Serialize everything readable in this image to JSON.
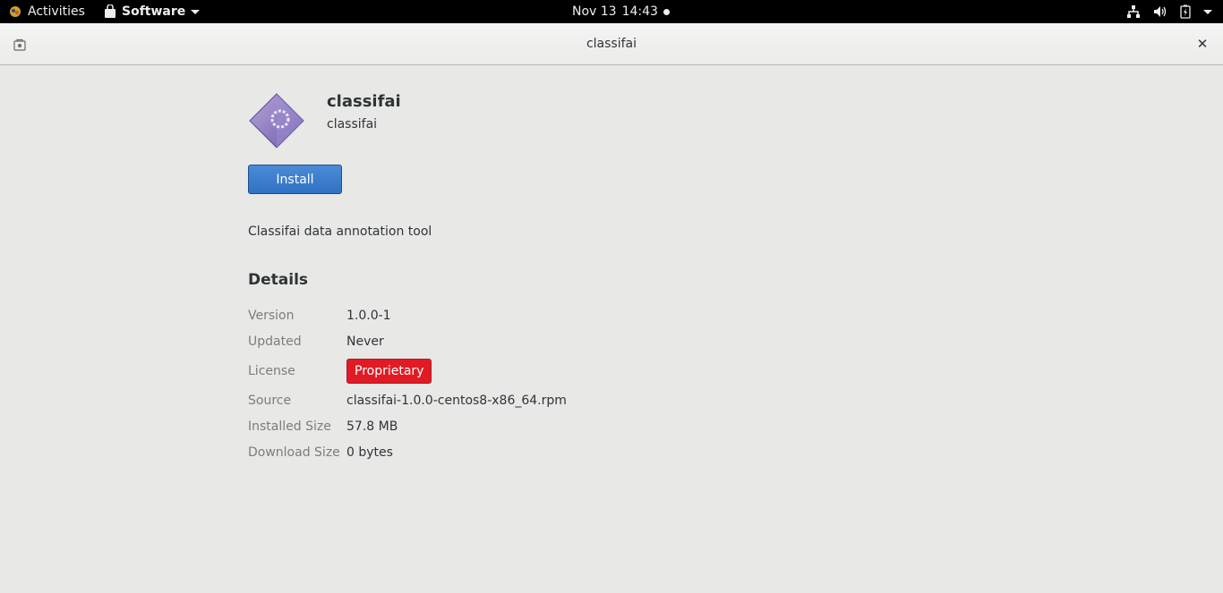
{
  "topbar": {
    "activities_label": "Activities",
    "app_menu_label": "Software",
    "date": "Nov 13",
    "time": "14:43",
    "status_icons": [
      "network-icon",
      "volume-icon",
      "battery-icon",
      "system-menu-chevron-icon"
    ]
  },
  "window": {
    "title": "classifai"
  },
  "app": {
    "name": "classifai",
    "summary": "classifai",
    "install_label": "Install",
    "description": "Classifai data annotation tool"
  },
  "details": {
    "title": "Details",
    "version_label": "Version",
    "version_value": "1.0.0-1",
    "updated_label": "Updated",
    "updated_value": "Never",
    "license_label": "License",
    "license_value": "Proprietary",
    "source_label": "Source",
    "source_value": "classifai-1.0.0-centos8-x86_64.rpm",
    "installed_size_label": "Installed Size",
    "installed_size_value": "57.8 MB",
    "download_size_label": "Download Size",
    "download_size_value": "0 bytes"
  },
  "colors": {
    "install_button": "#3584e4",
    "license_badge": "#e01b24",
    "topbar": "#000000"
  }
}
